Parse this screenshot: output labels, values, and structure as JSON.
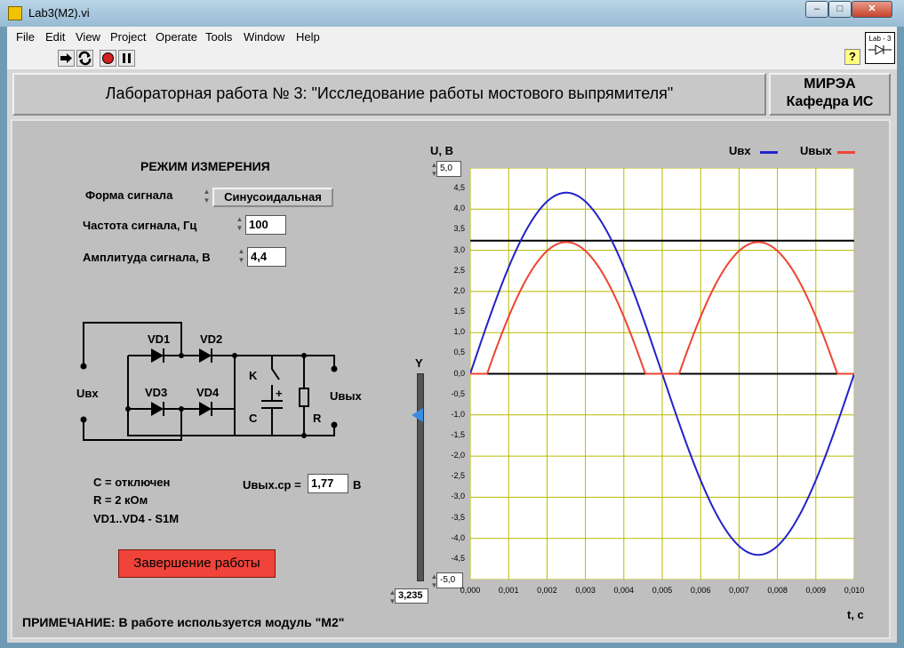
{
  "window": {
    "title": "Lab3(M2).vi",
    "min": "–",
    "max": "□",
    "close": "✕"
  },
  "menu": [
    "File",
    "Edit",
    "View",
    "Project",
    "Operate",
    "Tools",
    "Window",
    "Help"
  ],
  "toolbar": {
    "help": "?",
    "vi_icon": "Lab - 3"
  },
  "header": {
    "title": "Лабораторная работа № 3: \"Исследование работы мостового выпрямителя\"",
    "org1": "МИРЭА",
    "org2": "Кафедра ИС"
  },
  "controls": {
    "mode_title": "РЕЖИМ ИЗМЕРЕНИЯ",
    "signal_form_label": "Форма сигнала",
    "signal_form_value": "Синусоидальная",
    "freq_label": "Частота сигнала, Гц",
    "freq_value": "100",
    "amp_label": "Амплитуда сигнала, В",
    "amp_value": "4,4"
  },
  "circuit": {
    "vd1": "VD1",
    "vd2": "VD2",
    "vd3": "VD3",
    "vd4": "VD4",
    "uin": "Uвх",
    "uout": "Uвых",
    "k": "K",
    "plus": "+",
    "c": "C",
    "r": "R"
  },
  "info": {
    "c_line": "C =   отключен",
    "r_line": "R = 2 кОм",
    "diodes_line": "VD1..VD4 - S1M",
    "uavg_label": "Uвых.ср =",
    "uavg_value": "1,77",
    "uavg_unit": "В"
  },
  "slider": {
    "label": "Y",
    "value": "3,235"
  },
  "stop_button": "Завершение работы",
  "note": "ПРИМЕЧАНИЕ: В работе используется модуль \"М2\"",
  "chart_data": {
    "type": "line",
    "ylabel": "U, В",
    "xlabel": "t, с",
    "xlim": [
      0,
      0.01
    ],
    "ylim": [
      -5,
      5
    ],
    "yticks": [
      "4,5",
      "4,0",
      "3,5",
      "3,0",
      "2,5",
      "2,0",
      "1,5",
      "1,0",
      "0,5",
      "0,0",
      "-0,5",
      "-1,0",
      "-1,5",
      "-2,0",
      "-2,5",
      "-3,0",
      "-3,5",
      "-4,0",
      "-4,5"
    ],
    "ymax_label": "5,0",
    "ymin_label": "-5,0",
    "xticks": [
      "0,000",
      "0,001",
      "0,002",
      "0,003",
      "0,004",
      "0,005",
      "0,006",
      "0,007",
      "0,008",
      "0,009",
      "0,010"
    ],
    "grid": true,
    "legend_placement": "top-right",
    "series": [
      {
        "name": "Uвх",
        "color": "#2222cc",
        "amplitude": 4.4,
        "frequency": 100,
        "form": "sine"
      },
      {
        "name": "Uвых",
        "color": "#ee4433",
        "peak": 3.2,
        "diode_drop": 1.2,
        "form": "full-wave rectified sine"
      }
    ],
    "cursor_level": 3.235,
    "zero_line": 0
  },
  "colors": {
    "plot_bg": "#ffffff",
    "grid": "#b8b800",
    "input_trace": "#2222cc",
    "output_trace": "#ee4433",
    "stop_button": "#f0443a"
  }
}
